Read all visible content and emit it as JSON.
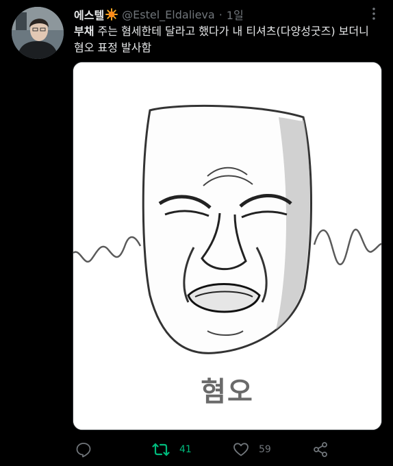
{
  "tweet": {
    "author": {
      "display_name": "에스텔",
      "handle": "@Estel_Eldalieva",
      "separator": "·",
      "time": "1일"
    },
    "text": {
      "bold_word": "부채",
      "rest": " 주는 혐세한테 달라고 했다가 내 티셔츠(다양성굿즈) 보더니 혐오 표정 발사함"
    },
    "media": {
      "caption": "혐오"
    },
    "actions": {
      "reply_count": "",
      "retweet_count": "41",
      "like_count": "59"
    }
  },
  "colors": {
    "background": "#000000",
    "text": "#e7e9ea",
    "muted": "#71767b",
    "retweet": "#00ba7c",
    "sun": "#f5a623"
  },
  "icons": [
    "sun-emoji-icon",
    "more-dots-icon",
    "reply-icon",
    "retweet-icon",
    "like-icon",
    "share-icon"
  ]
}
